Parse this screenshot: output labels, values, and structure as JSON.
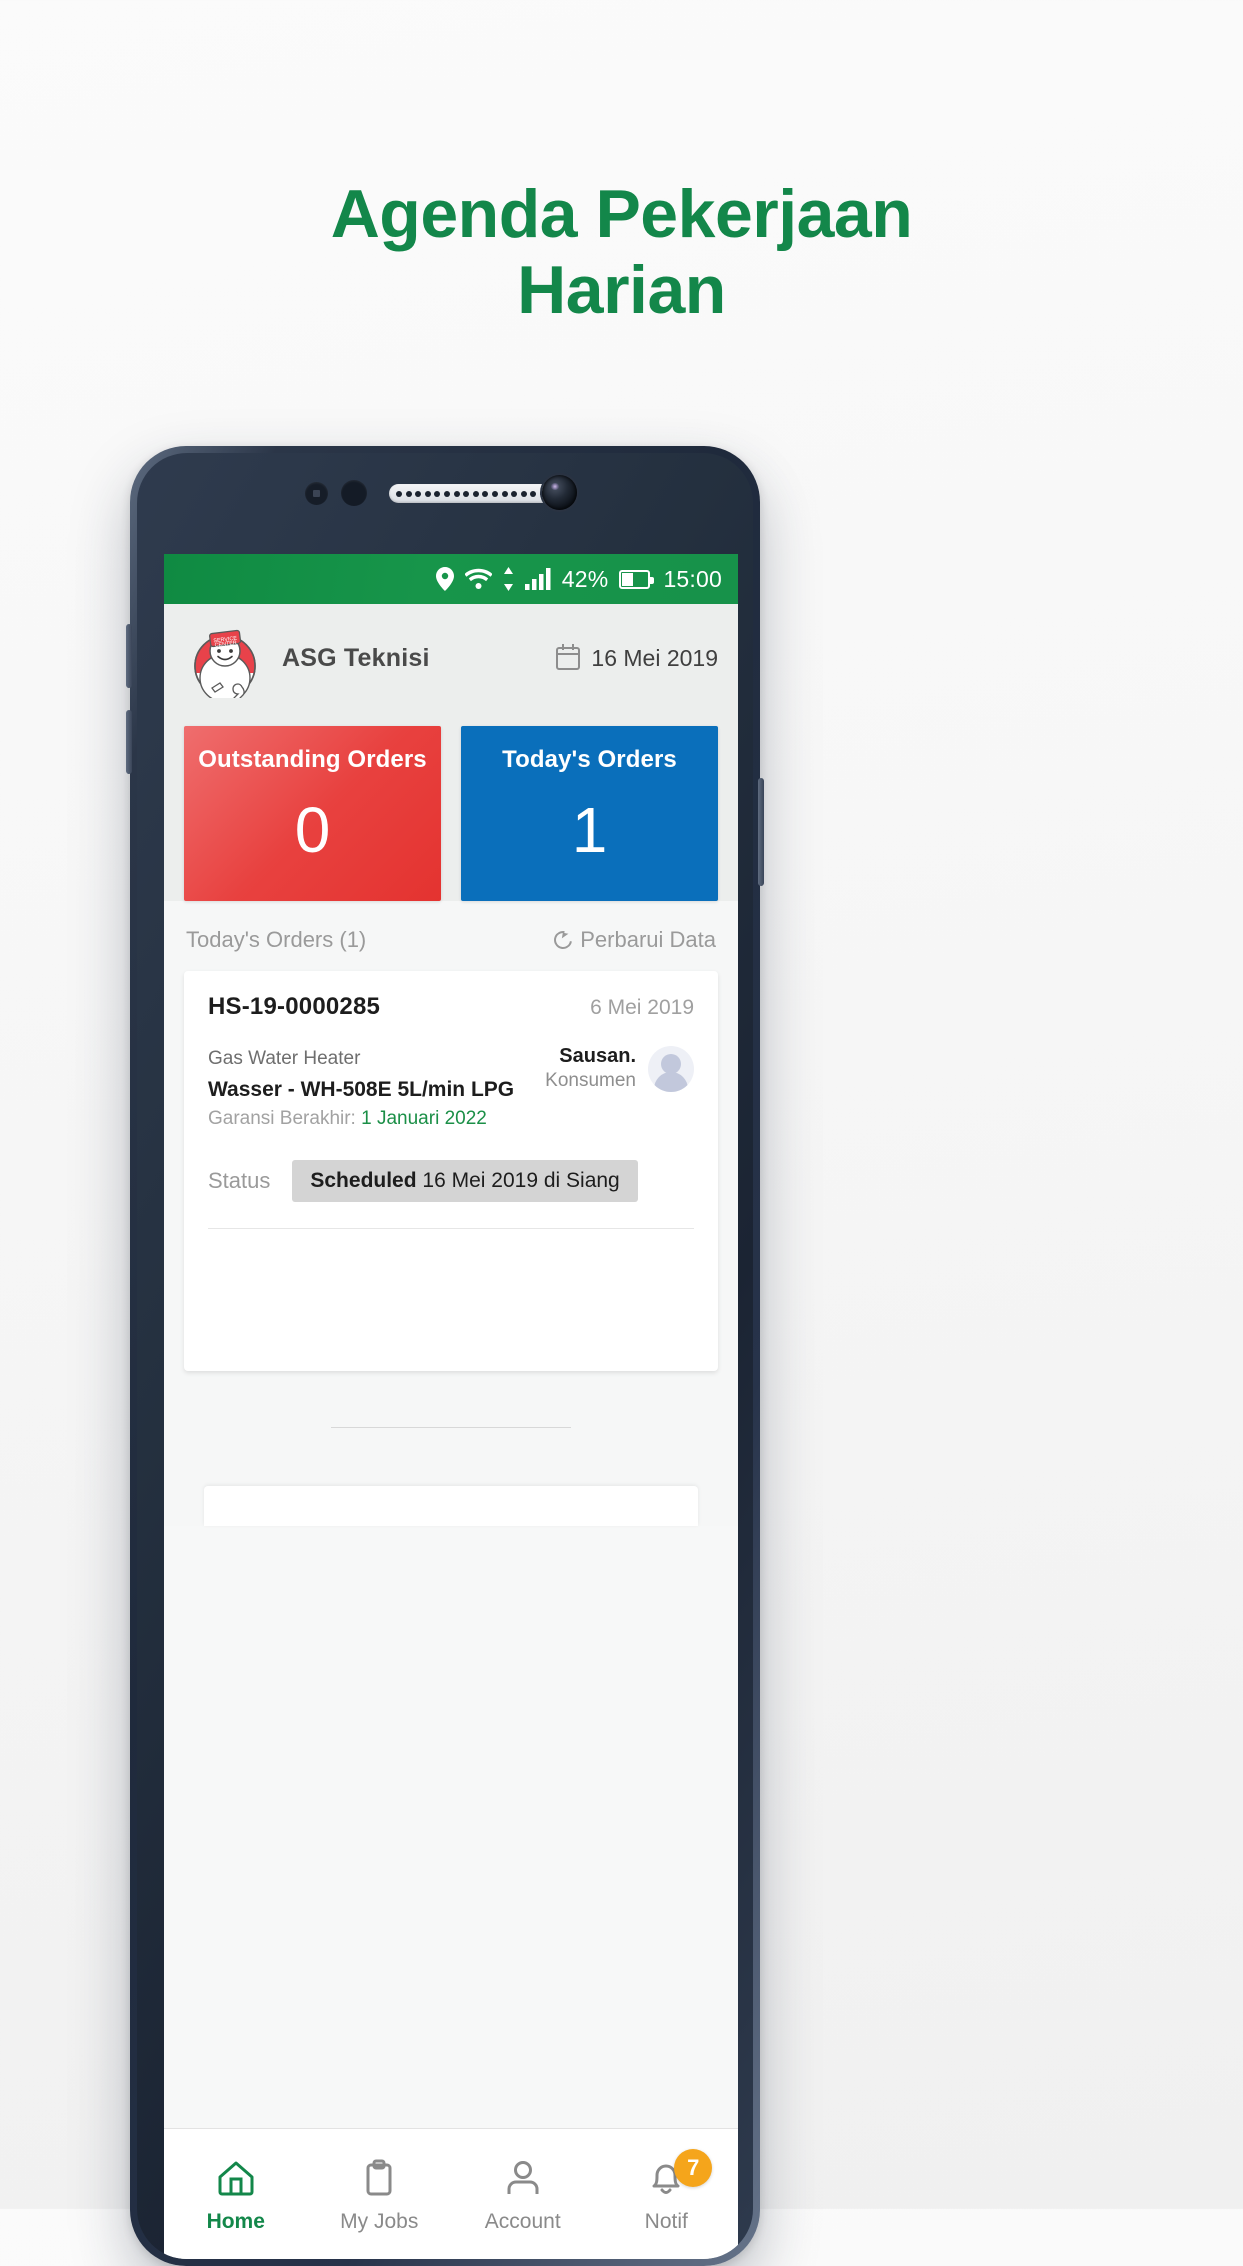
{
  "headline": {
    "line1": "Agenda Pekerjaan",
    "line2": "Harian",
    "color": "#13874a"
  },
  "status_bar": {
    "location_icon": "location-pin-icon",
    "wifi_icon": "wifi-icon",
    "data_arrows_icon": "data-transfer-arrows-icon",
    "signal_icon": "cellular-signal-icon",
    "battery_percent": "42%",
    "battery_icon": "battery-icon",
    "time": "15:00",
    "background": "#17924a"
  },
  "app_header": {
    "logo_icon": "service-center-mascot-logo",
    "brand_name": "ASG Teknisi",
    "calendar_icon": "calendar-icon",
    "date": "16 Mei 2019"
  },
  "stats": [
    {
      "title": "Outstanding Orders",
      "value": "0",
      "color": "#e43330",
      "name": "outstanding-orders-card"
    },
    {
      "title": "Today's Orders",
      "value": "1",
      "color": "#0a6fbb",
      "name": "todays-orders-card"
    }
  ],
  "section": {
    "title": "Today's Orders (1)",
    "refresh_icon": "refresh-icon",
    "refresh_label": "Perbarui Data"
  },
  "order": {
    "id": "HS-19-0000285",
    "date": "6 Mei 2019",
    "category": "Gas Water Heater",
    "product": "Wasser - WH-508E 5L/min LPG",
    "warranty_label": "Garansi Berakhir:",
    "warranty_date": "1 Januari 2022",
    "warranty_color": "#1b8f47",
    "customer_name": "Sausan.",
    "customer_role": "Konsumen",
    "avatar_icon": "user-avatar-icon",
    "status_label": "Status",
    "status_value": "Scheduled",
    "status_detail": "16 Mei 2019 di Siang"
  },
  "bottom_nav": [
    {
      "label": "Home",
      "icon": "home-icon",
      "active": true,
      "badge": null
    },
    {
      "label": "My Jobs",
      "icon": "clipboard-icon",
      "active": false,
      "badge": null
    },
    {
      "label": "Account",
      "icon": "person-icon",
      "active": false,
      "badge": null
    },
    {
      "label": "Notif",
      "icon": "bell-icon",
      "active": false,
      "badge": "7"
    }
  ]
}
